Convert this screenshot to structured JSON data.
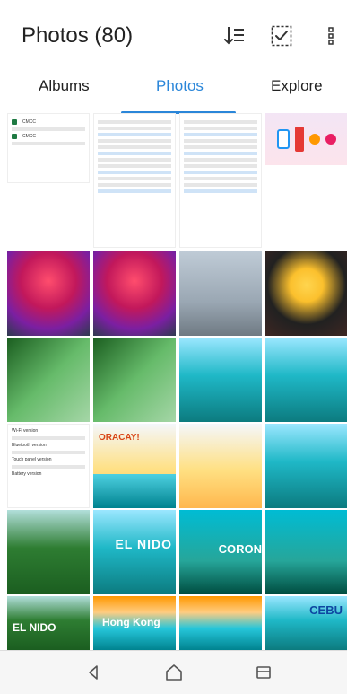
{
  "header": {
    "title": "Photos (80)",
    "sort_icon": "sort-icon",
    "select_icon": "select-icon",
    "more_icon": "more-vert-icon"
  },
  "tabs": [
    {
      "label": "Albums",
      "active": false
    },
    {
      "label": "Photos",
      "active": true
    },
    {
      "label": "Explore",
      "active": false
    }
  ],
  "thumbnails": {
    "contacts": {
      "line1": "CMCC",
      "line2": "CMCC"
    },
    "settings": {
      "r1": "Wi-Fi version",
      "r2": "Bluetooth version",
      "r3": "Touch panel version",
      "r4": "Battery version"
    },
    "beach_label": "ORACAY!",
    "elnido": "EL NIDO",
    "coron": "CORON",
    "hongkong": "Hong Kong",
    "cebu": "CEBU"
  },
  "navbar": {
    "back_icon": "back-icon",
    "home_icon": "home-icon",
    "recents_icon": "recents-icon"
  },
  "colors": {
    "accent": "#2a86d9"
  }
}
